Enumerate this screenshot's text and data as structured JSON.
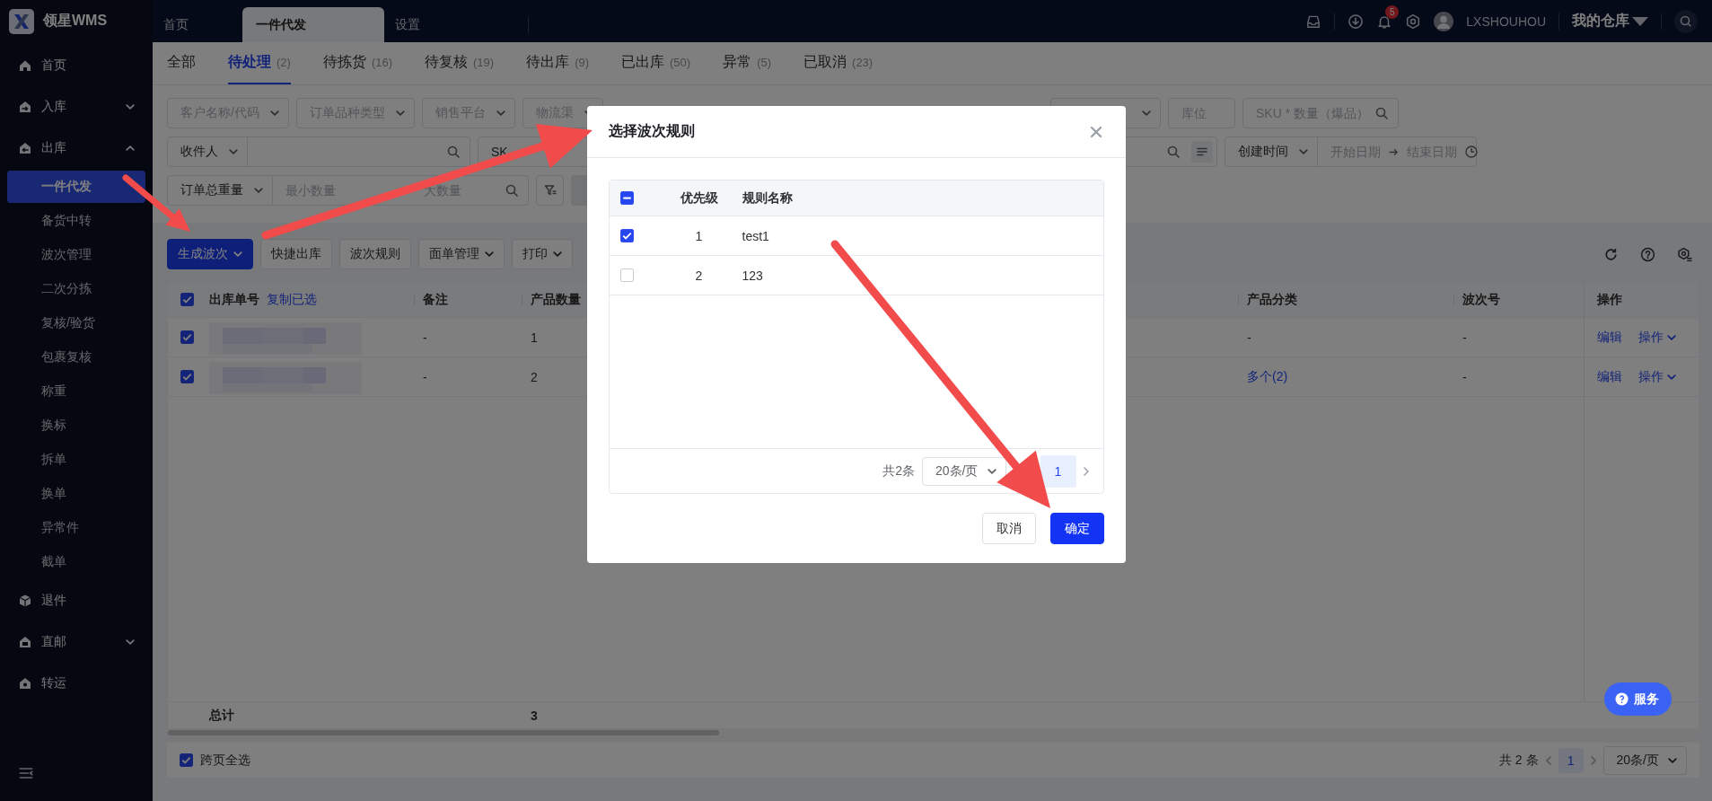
{
  "app": {
    "logo_text": "领星WMS"
  },
  "top_tabs": [
    {
      "label": "首页",
      "selected": false
    },
    {
      "label": "一件代发",
      "selected": true
    },
    {
      "label": "设置",
      "selected": false
    }
  ],
  "header": {
    "notification_count": "5",
    "username": "LXSHOUHOU",
    "warehouse": "我的仓库"
  },
  "sidebar": {
    "items": [
      {
        "label": "首页"
      },
      {
        "label": "入库",
        "expanded": false
      },
      {
        "label": "出库",
        "expanded": true,
        "children": [
          {
            "label": "一件代发",
            "selected": true
          },
          {
            "label": "备货中转",
            "selected": false
          },
          {
            "label": "波次管理",
            "selected": false
          },
          {
            "label": "二次分拣",
            "selected": false
          },
          {
            "label": "复核/验货",
            "selected": false
          },
          {
            "label": "包裹复核",
            "selected": false
          },
          {
            "label": "称重",
            "selected": false
          },
          {
            "label": "换标",
            "selected": false
          },
          {
            "label": "拆单",
            "selected": false
          },
          {
            "label": "换单",
            "selected": false
          },
          {
            "label": "异常件",
            "selected": false
          },
          {
            "label": "截单",
            "selected": false
          }
        ]
      },
      {
        "label": "退件"
      },
      {
        "label": "直邮",
        "expanded": false
      },
      {
        "label": "转运"
      }
    ]
  },
  "status_tabs": [
    {
      "label": "全部",
      "selected": false
    },
    {
      "label": "待处理",
      "count": "(2)",
      "selected": true
    },
    {
      "label": "待拣货",
      "count": "(16)",
      "selected": false
    },
    {
      "label": "待复核",
      "count": "(19)",
      "selected": false
    },
    {
      "label": "待出库",
      "count": "(9)",
      "selected": false
    },
    {
      "label": "已出库",
      "count": "(50)",
      "selected": false
    },
    {
      "label": "异常",
      "count": "(5)",
      "selected": false
    },
    {
      "label": "已取消",
      "count": "(23)",
      "selected": false
    }
  ],
  "filters": [
    {
      "left": [
        {
          "kind": "select",
          "placeholder": "客户名称/代码"
        },
        {
          "kind": "select",
          "placeholder": "订单品种类型"
        },
        {
          "kind": "select",
          "placeholder": "销售平台"
        },
        {
          "kind": "select",
          "placeholder": "物流渠"
        }
      ],
      "right": [
        {
          "kind": "select"
        },
        {
          "kind": "input",
          "placeholder": "库位"
        },
        {
          "kind": "search",
          "placeholder": "SKU * 数量（爆品）"
        }
      ]
    },
    {
      "left": [
        {
          "kind": "select-search",
          "value": "收件人"
        },
        {
          "kind": "select-partial",
          "value": "SK"
        }
      ],
      "right": [
        {
          "kind": "search-list"
        },
        {
          "kind": "select-daterange",
          "value": "创建时间",
          "start_placeholder": "开始日期",
          "end_placeholder": "结束日期"
        }
      ]
    },
    {
      "left": [
        {
          "kind": "select-range",
          "value": "订单总重量",
          "min_placeholder": "最小数量",
          "max_placeholder": "大数量"
        },
        {
          "kind": "filter-button"
        },
        {
          "kind": "button"
        }
      ]
    }
  ],
  "toolbar": [
    {
      "label": "生成波次",
      "kind": "primary",
      "dropdown": true
    },
    {
      "label": "快捷出库",
      "kind": "default",
      "dropdown": false
    },
    {
      "label": "波次规则",
      "kind": "default",
      "dropdown": false
    },
    {
      "label": "面单管理",
      "kind": "default",
      "dropdown": true
    },
    {
      "label": "打印",
      "kind": "default",
      "dropdown": true
    }
  ],
  "table": {
    "all_checked": true,
    "columns": [
      {
        "label": "出库单号",
        "link": "复制已选"
      },
      {
        "label": "备注"
      },
      {
        "label": "产品数量"
      },
      {
        "label": "产品分类"
      },
      {
        "label": "波次号"
      },
      {
        "label": "操作"
      }
    ],
    "rows": [
      {
        "selected": true,
        "remark": "-",
        "quantity": "1",
        "category": {
          "text": "-",
          "link": false
        },
        "wave_no": "-",
        "actions": [
          {
            "label": "编辑",
            "dropdown": false
          },
          {
            "label": "操作",
            "dropdown": true
          }
        ]
      },
      {
        "selected": true,
        "remark": "-",
        "quantity": "2",
        "category": {
          "text": "多个(2)",
          "link": true
        },
        "wave_no": "-",
        "actions": [
          {
            "label": "编辑",
            "dropdown": false
          },
          {
            "label": "操作",
            "dropdown": true
          }
        ]
      }
    ],
    "total": {
      "label": "总计",
      "quantity": "3"
    }
  },
  "footer": {
    "select_all_pages": {
      "label": "跨页全选",
      "checked": true
    },
    "total": "共 2 条",
    "pages": [
      {
        "label": "1",
        "selected": true
      }
    ],
    "page_size": "20条/页"
  },
  "service_button": "服务",
  "modal": {
    "title": "选择波次规则",
    "header_indeterminate": true,
    "columns": [
      "优先级",
      "规则名称"
    ],
    "rows": [
      {
        "priority": "1",
        "name": "test1",
        "selected": true
      },
      {
        "priority": "2",
        "name": "123",
        "selected": false
      }
    ],
    "pagination": {
      "total": "共2条",
      "page_size": "20条/页",
      "pages": [
        {
          "label": "1",
          "selected": true
        }
      ]
    },
    "buttons": [
      {
        "label": "取消",
        "kind": "default"
      },
      {
        "label": "确定",
        "kind": "primary"
      }
    ]
  }
}
